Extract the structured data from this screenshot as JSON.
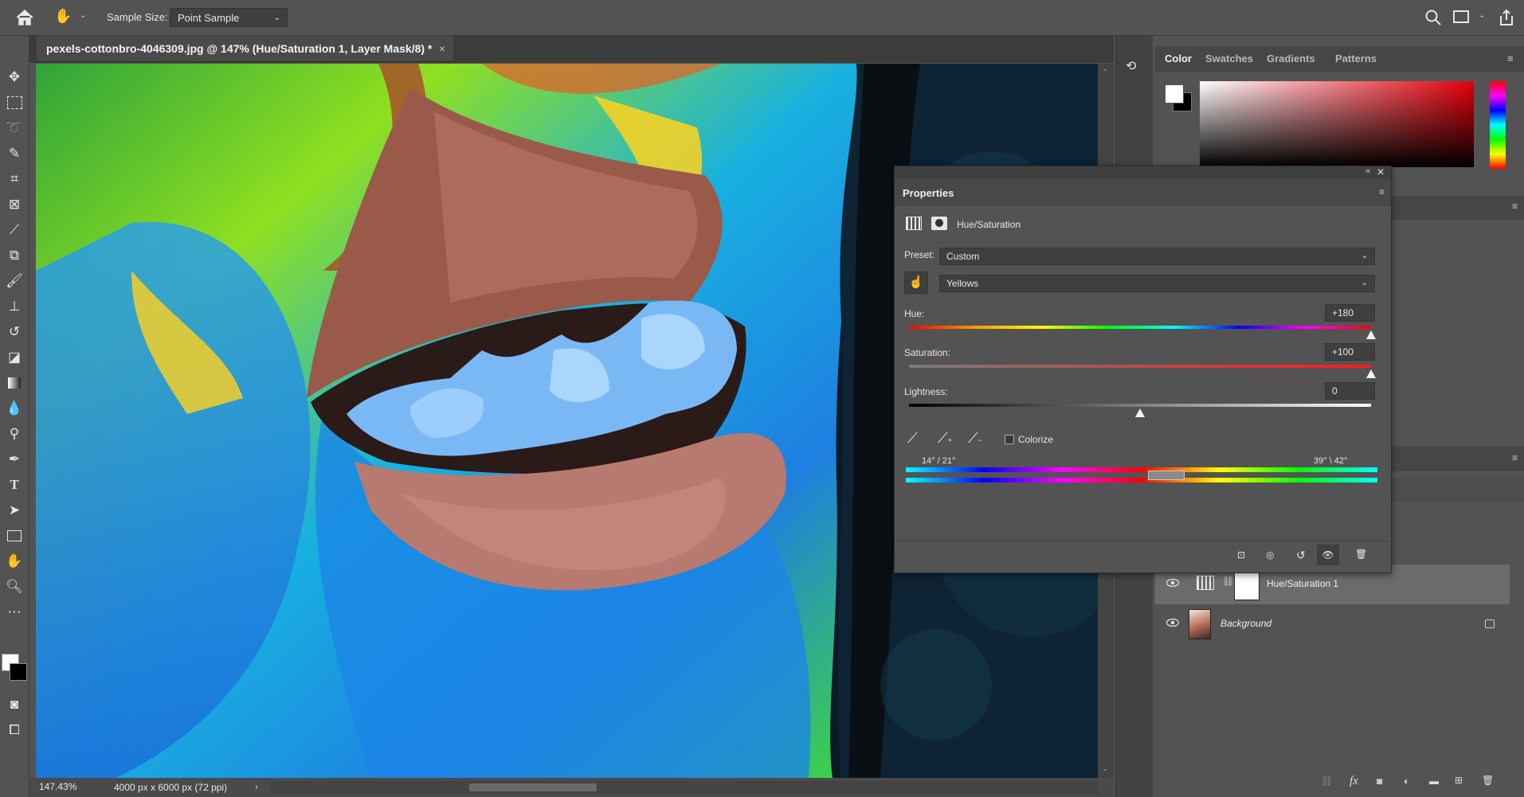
{
  "options_bar": {
    "sample_size_label": "Sample Size:",
    "sample_size_value": "Point Sample"
  },
  "document": {
    "tab_title": "pexels-cottonbro-4046309.jpg @ 147% (Hue/Saturation 1, Layer Mask/8) *",
    "zoom": "147.43%",
    "doc_info": "4000 px x 6000 px (72 ppi)"
  },
  "color_panel": {
    "tabs": [
      "Color",
      "Swatches",
      "Gradients",
      "Patterns"
    ],
    "active_tab": "Color"
  },
  "properties": {
    "title": "Properties",
    "adjustment_name": "Hue/Saturation",
    "preset_label": "Preset:",
    "preset_value": "Custom",
    "channel_value": "Yellows",
    "hue_label": "Hue:",
    "hue_value": "+180",
    "hue_fraction": 1.0,
    "saturation_label": "Saturation:",
    "saturation_value": "+100",
    "saturation_fraction": 1.0,
    "lightness_label": "Lightness:",
    "lightness_value": "0",
    "lightness_fraction": 0.5,
    "colorize_label": "Colorize",
    "range_left": "14° / 21°",
    "range_right": "39° \\ 42°"
  },
  "layers": [
    {
      "name": "Hue/Saturation 1",
      "italic": false,
      "selected": true
    },
    {
      "name": "Background",
      "italic": true,
      "selected": false
    }
  ],
  "colors": {
    "panel_bg": "#535353",
    "dark_bg": "#3f3f3f",
    "text": "#d6d6d6"
  }
}
